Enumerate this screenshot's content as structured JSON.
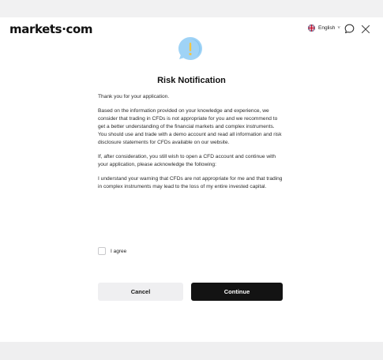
{
  "header": {
    "logo_text": "markets·com",
    "language_label": "English",
    "language_chevron": "˅"
  },
  "icons": {
    "alert": "alert-bubble-icon",
    "chat": "chat-icon",
    "close": "close-icon",
    "flag": "uk-flag-icon"
  },
  "dialog": {
    "title": "Risk Notification",
    "paragraphs": [
      "Thank you for your application.",
      "Based on the information provided on your knowledge and experience, we consider that trading in CFDs is not appropriate for you and we recommend to get a better understanding of the financial markets and complex instruments. You should use and trade with a demo account and read all information and risk disclosure statements for CFDs available on our website.",
      "If, after consideration, you still wish to open a CFD account and continue with your application, please acknowledge the following:",
      "I understand your warning that CFDs are not appropriate for me and that trading in complex instruments may lead to the loss of my entire invested capital."
    ],
    "agree_label": "I agree",
    "agree_checked": false,
    "cancel_label": "Cancel",
    "continue_label": "Continue"
  },
  "colors": {
    "accent": "#f5b000",
    "alert_blue": "#8ecbf3",
    "continue_bg": "#131313",
    "cancel_bg": "#efeff1"
  }
}
